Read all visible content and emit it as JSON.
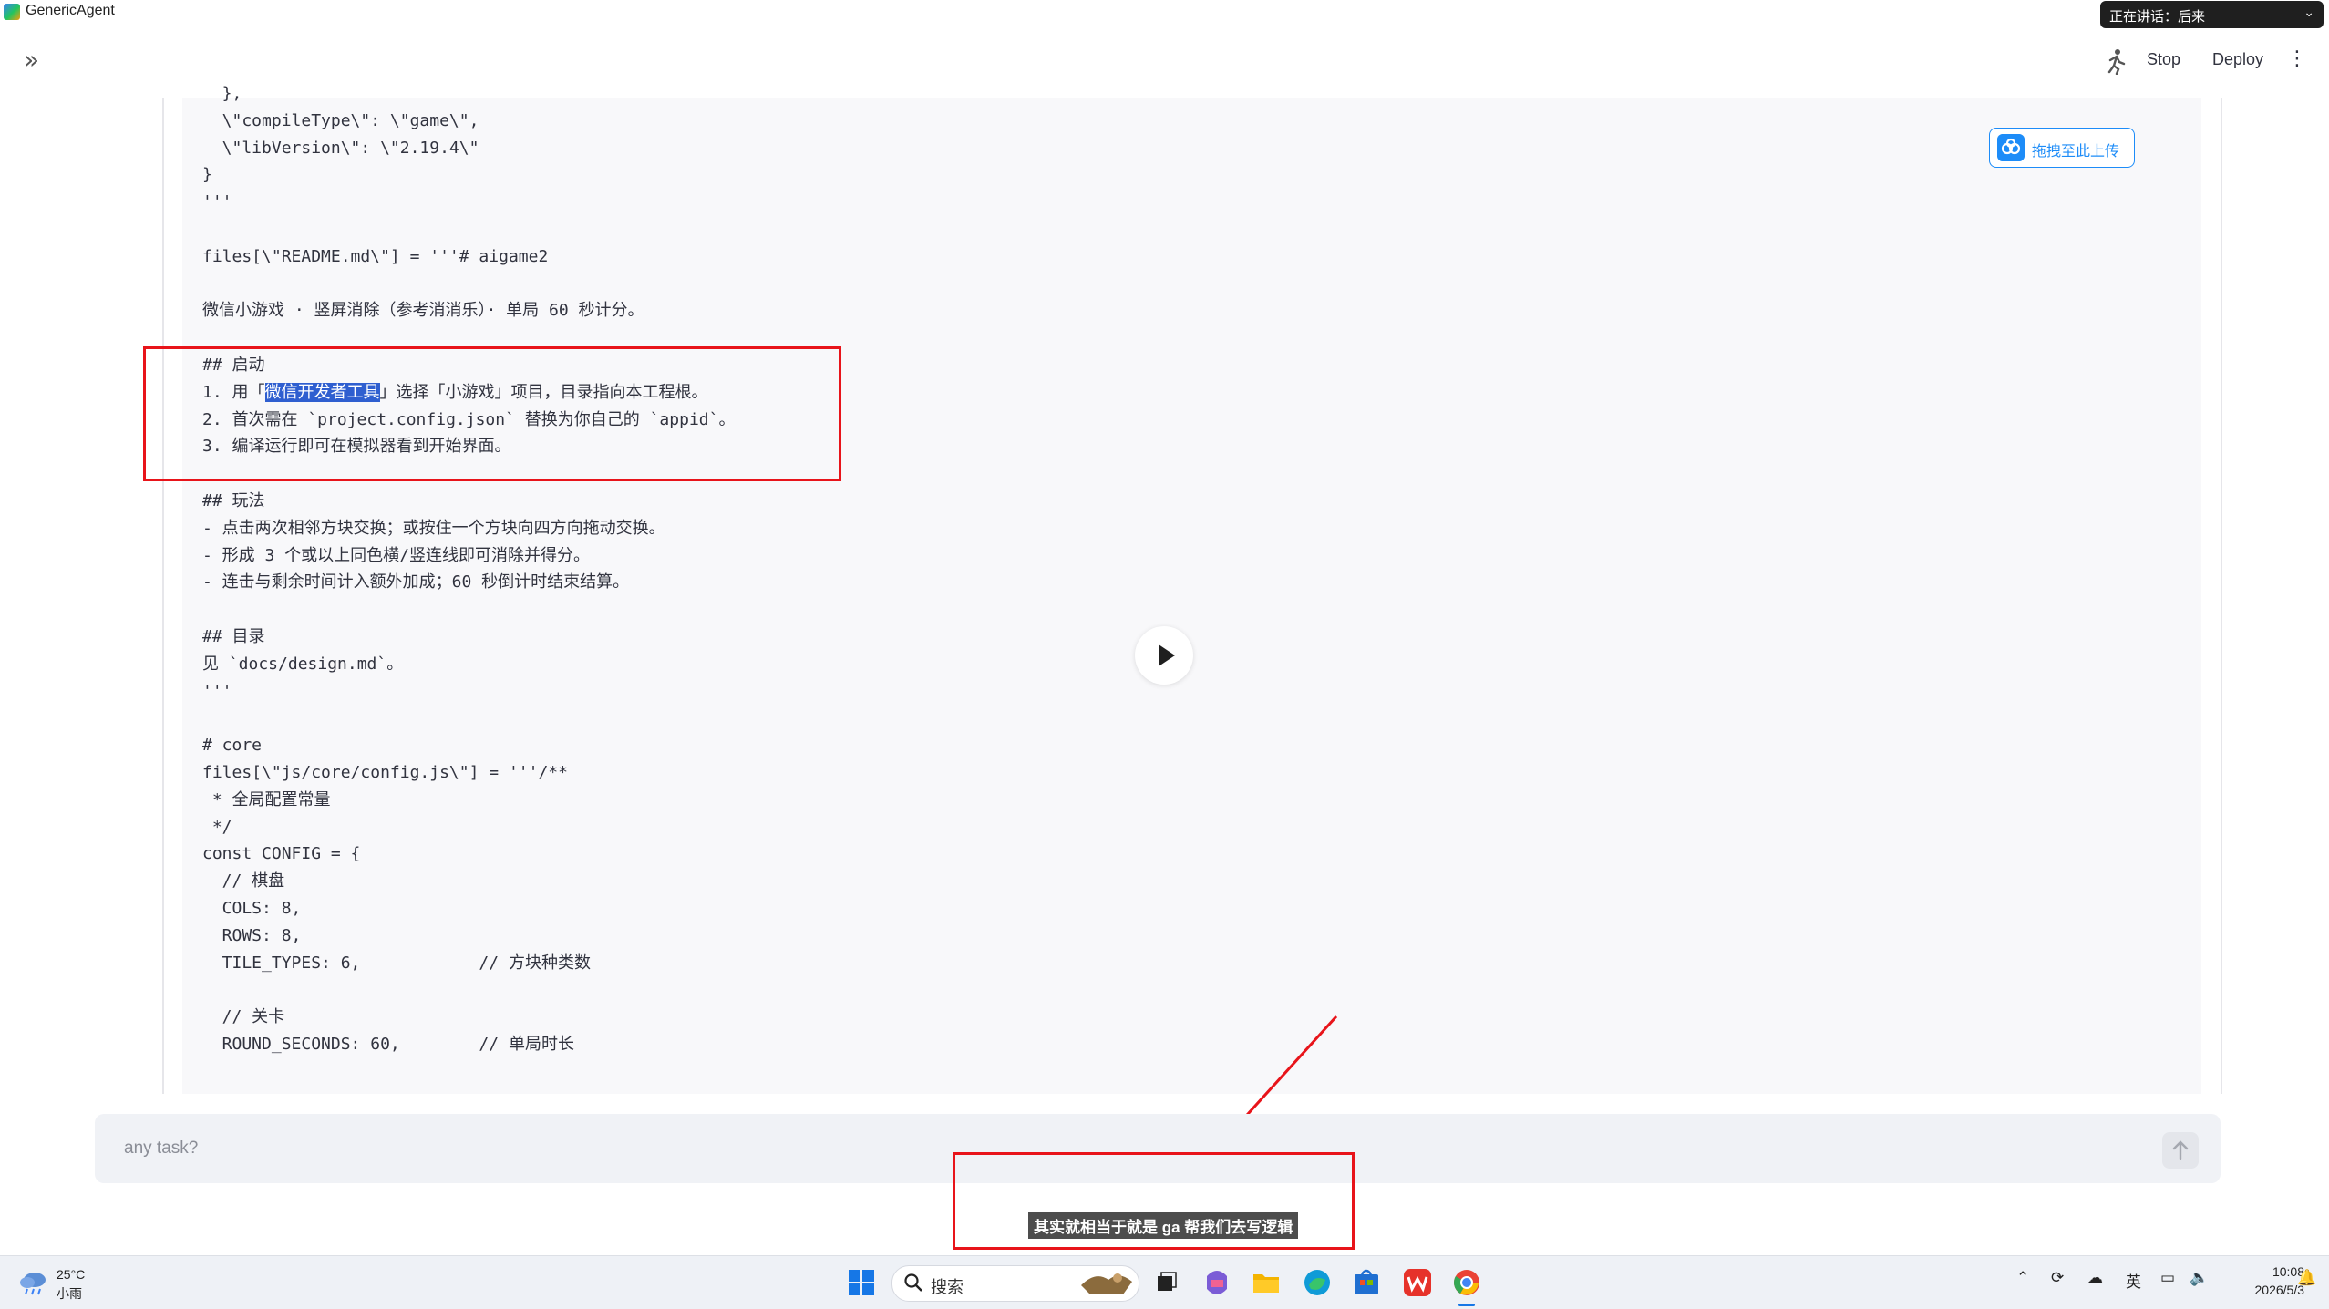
{
  "window": {
    "title": "GenericAgent"
  },
  "speaking": {
    "text": "正在讲话：后来"
  },
  "header": {
    "stop_label": "Stop",
    "deploy_label": "Deploy",
    "more_glyph": "⋮",
    "collapse_glyph": "»"
  },
  "upload": {
    "label": "拖拽至此上传"
  },
  "code": {
    "lines": [
      "  },",
      "  \\\"compileType\\\": \\\"game\\\",",
      "  \\\"libVersion\\\": \\\"2.19.4\\\"",
      "}",
      "'''",
      "",
      "files[\\\"README.md\\\"] = '''# aigame2",
      "",
      "微信小游戏 · 竖屏消除（参考消消乐）· 单局 60 秒计分。",
      "",
      "## 启动",
      "1. 用「微信开发者工具」选择「小游戏」项目，目录指向本工程根。",
      "2. 首次需在 `project.config.json` 替换为你自己的 `appid`。",
      "3. 编译运行即可在模拟器看到开始界面。",
      "",
      "## 玩法",
      "- 点击两次相邻方块交换；或按住一个方块向四方向拖动交换。",
      "- 形成 3 个或以上同色横/竖连线即可消除并得分。",
      "- 连击与剩余时间计入额外加成；60 秒倒计时结束结算。",
      "",
      "## 目录",
      "见 `docs/design.md`。",
      "'''",
      "",
      "# core",
      "files[\\\"js/core/config.js\\\"] = '''/**",
      " * 全局配置常量",
      " */",
      "const CONFIG = {",
      "  // 棋盘",
      "  COLS: 8,",
      "  ROWS: 8,",
      "  TILE_TYPES: 6,            // 方块种类数",
      "",
      "  // 关卡",
      "  ROUND_SECONDS: 60,        // 单局时长"
    ],
    "selection": {
      "line": 11,
      "before": "1. 用「",
      "selected": "微信开发者工具",
      "after": "」选择「小游戏」项目，目录指向本工程根。"
    }
  },
  "chat": {
    "placeholder": "any task?"
  },
  "subtitle": {
    "text": "其实就相当于就是 ga 帮我们去写逻辑"
  },
  "taskbar": {
    "weather_temp": "25°C",
    "weather_desc": "小雨",
    "search_placeholder": "搜索",
    "ime": "英",
    "time": "10:08",
    "date": "2026/5/3"
  },
  "colors": {
    "accent": "#1d8cf8",
    "annotation": "#e8141a",
    "selection": "#2f5fd0"
  }
}
